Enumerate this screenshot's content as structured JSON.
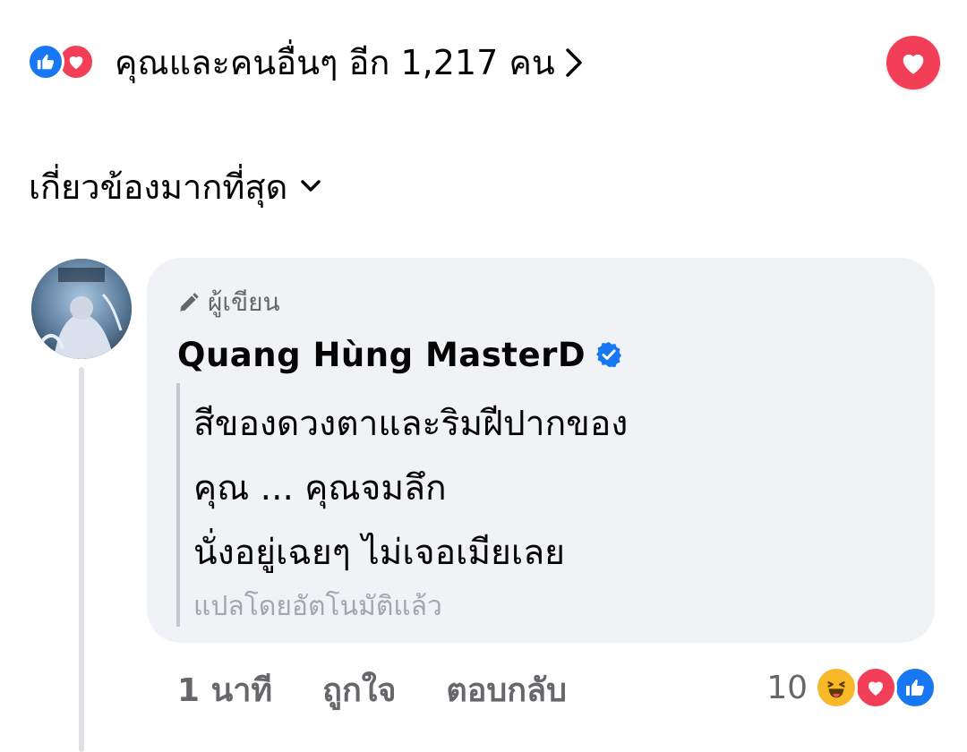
{
  "reactions_summary": {
    "text": "คุณและคนอื่นๆ อีก 1,217 คน",
    "icons": [
      "like-icon",
      "love-icon"
    ],
    "action_icon": "love-icon"
  },
  "sort": {
    "label": "เกี่ยวข้องมากที่สุด"
  },
  "comment": {
    "author_badge": "ผู้เขียน",
    "author_name": "Quang Hùng MasterD",
    "verified": true,
    "lines": [
      "สีของดวงตาและริมฝีปากของ",
      "คุณ ... คุณจมลึก",
      "นั่งอยู่เฉยๆ ไม่เจอเมียเลย"
    ],
    "translated_note": "แปลโดยอัตโนมัติแล้ว",
    "time": "1 นาที",
    "like_label": "ถูกใจ",
    "reply_label": "ตอบกลับ",
    "reaction_count": "10",
    "reaction_icons": [
      "haha-icon",
      "love-icon",
      "like-icon"
    ]
  },
  "colors": {
    "accent_blue": "#1877f2",
    "love_red": "#f33e58",
    "haha_yellow": "#f7b928",
    "bubble_bg": "#f0f2f5",
    "secondary_text": "#65676b"
  }
}
